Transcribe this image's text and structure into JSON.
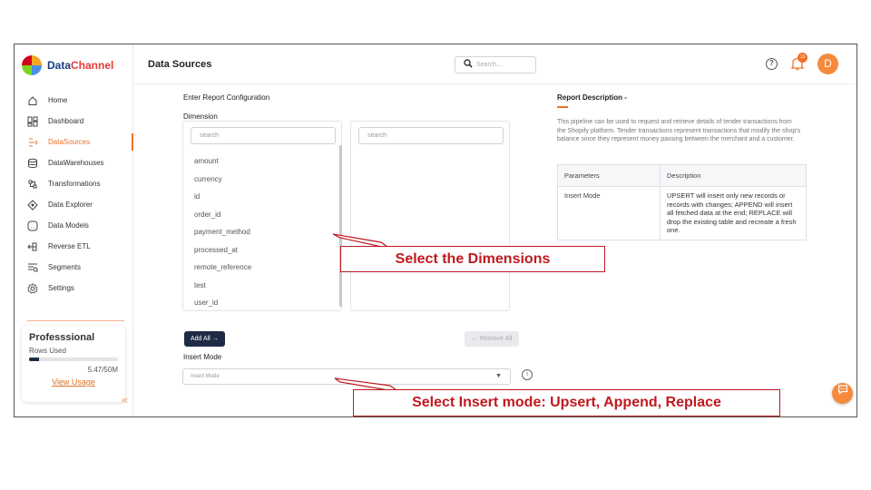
{
  "brand": {
    "name_a": "Data",
    "name_b": "Channel"
  },
  "header": {
    "title": "Data Sources",
    "search_placeholder": "Search..."
  },
  "notifications": {
    "count": "13"
  },
  "user": {
    "initial": "D"
  },
  "sidebar": {
    "items": [
      {
        "label": "Home",
        "icon": "home-icon"
      },
      {
        "label": "Dashboard",
        "icon": "dashboard-icon"
      },
      {
        "label": "DataSources",
        "icon": "datasources-icon",
        "active": true
      },
      {
        "label": "DataWarehouses",
        "icon": "database-icon"
      },
      {
        "label": "Transformations",
        "icon": "transform-icon"
      },
      {
        "label": "Data Explorer",
        "icon": "explorer-icon"
      },
      {
        "label": "Data Models",
        "icon": "models-icon"
      },
      {
        "label": "Reverse ETL",
        "icon": "reverse-etl-icon"
      },
      {
        "label": "Segments",
        "icon": "segments-icon"
      },
      {
        "label": "Settings",
        "icon": "gear-icon"
      }
    ]
  },
  "plan": {
    "title": "Professsional",
    "rows_used_label": "Rows Used",
    "usage": "5.47/50M",
    "usage_fraction": 0.11,
    "link": "View Usage"
  },
  "config": {
    "section_title": "Enter Report Configuration",
    "dimension_label": "Dimension",
    "left_search_placeholder": "search",
    "right_search_placeholder": "search",
    "dimensions": [
      "amount",
      "currency",
      "id",
      "order_id",
      "payment_method",
      "processed_at",
      "remote_reference",
      "test",
      "user_id"
    ],
    "add_all": "Add All →",
    "remove_all": "← Remove All",
    "insert_mode_label": "Insert Mode",
    "insert_mode_placeholder": "Insert Mode"
  },
  "description": {
    "title": "Report Description -",
    "text": "This pipeline can be used to request and retrieve details of tender transactions from the Shopify platform. Tender transactions represent transactions that modify the shop's balance since they represent money passing between the merchant and a customer.",
    "table_header_1": "Parameters",
    "table_header_2": "Description",
    "row_param": "Insert Mode",
    "row_desc": "UPSERT will insert only new records or records with changes; APPEND will insert all fetched data at the end; REPLACE will drop the existing table and recreate a fresh one."
  },
  "annotations": {
    "dimensions": "Select the Dimensions",
    "insert_mode": "Select Insert mode: Upsert, Append, Replace"
  },
  "colors": {
    "accent": "#f07028",
    "annotation": "#c0191f",
    "dark_button": "#1f2b46"
  }
}
